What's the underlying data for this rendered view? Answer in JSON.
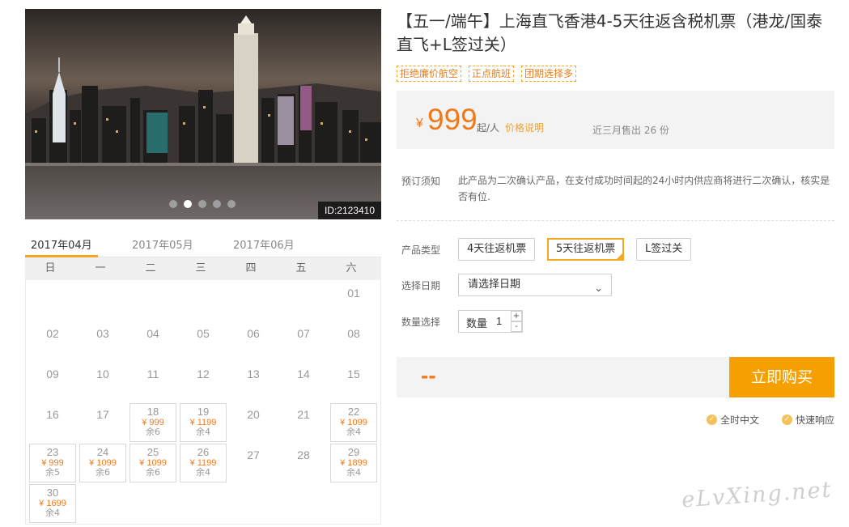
{
  "gallery": {
    "image_id": "ID:2123410",
    "dot_count": 5,
    "active_dot": 1
  },
  "calendar": {
    "months": [
      "2017年04月",
      "2017年05月",
      "2017年06月"
    ],
    "active_month": 0,
    "weekdays": [
      "日",
      "一",
      "二",
      "三",
      "四",
      "五",
      "六"
    ],
    "first_weekday": 6,
    "days_in_month": 30,
    "prices": {
      "18": {
        "price": "¥ 999",
        "remain": "余6"
      },
      "19": {
        "price": "¥ 1199",
        "remain": "余4"
      },
      "22": {
        "price": "¥ 1099",
        "remain": "余4"
      },
      "23": {
        "price": "¥ 999",
        "remain": "余5"
      },
      "24": {
        "price": "¥ 1099",
        "remain": "余6"
      },
      "25": {
        "price": "¥ 1099",
        "remain": "余6"
      },
      "26": {
        "price": "¥ 1199",
        "remain": "余4"
      },
      "29": {
        "price": "¥ 1899",
        "remain": "余4"
      },
      "30": {
        "price": "¥ 1699",
        "remain": "余4"
      }
    }
  },
  "product": {
    "title": "【五一/端午】上海直飞香港4-5天往返含税机票（港龙/国泰直飞+L签过关）",
    "tags": [
      "拒绝廉价航空",
      "正点航班",
      "团期选择多"
    ]
  },
  "price": {
    "currency": "¥",
    "amount": "999",
    "unit": "起/人",
    "explain_link": "价格说明",
    "sold": "近三月售出 26 份"
  },
  "notice": {
    "label": "预订须知",
    "text": "此产品为二次确认产品，在支付成功时间起的24小时内供应商将进行二次确认，核实是否有位."
  },
  "options": {
    "type_label": "产品类型",
    "types": [
      "4天往返机票",
      "5天往返机票",
      "L签过关"
    ],
    "selected_type": 1,
    "date_label": "选择日期",
    "date_placeholder": "请选择日期",
    "qty_label": "数量选择",
    "qty_text": "数量",
    "qty_value": "1",
    "plus": "+",
    "minus": "-"
  },
  "buy": {
    "total": "--",
    "button": "立即购买"
  },
  "guarantees": [
    "全时中文",
    "快速响应"
  ],
  "watermark": "eLvXing.net",
  "colors": {
    "accent": "#f5a000",
    "price": "#f07a1a"
  }
}
